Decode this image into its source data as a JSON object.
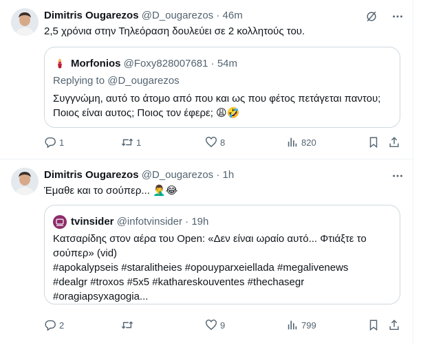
{
  "tweets": [
    {
      "author_name": "Dimitris Ougarezos",
      "handle": "@D_ougarezos",
      "dot": "·",
      "time": "46m",
      "text": "2,5 χρόνια στην Τηλεόραση δουλεύει σε 2 κολλητούς του.",
      "quote": {
        "author_name": "Morfonios",
        "handle": "@Foxy828007681",
        "time": "54m",
        "replying_to": "Replying to @D_ougarezos",
        "text_line1": "Συγγνώμη, αυτό το άτομο από που και ως που φέτος πετάγεται παντου;",
        "text_line2": "Ποιος είναι αυτος; Ποιος τον έφερε; 😩🤣"
      },
      "stats": {
        "replies": "1",
        "retweets": "1",
        "likes": "8",
        "views": "820"
      }
    },
    {
      "author_name": "Dimitris Ougarezos",
      "handle": "@D_ougarezos",
      "dot": "·",
      "time": "1h",
      "text": "Έμαθε και το σούπερ... 🤦‍♂️😂",
      "quote": {
        "author_name": "tvinsider",
        "handle": "@infotvinsider",
        "time": "19h",
        "text_line1": "Κατσαρίδης στον αέρα του Open: «Δεν είναι ωραίο αυτό... Φτιάξτε το",
        "text_line2": "σούπερ» (vid)",
        "text_line3": "#apokalypseis #staralitheies #opouyparxeiellada #megalivenews",
        "text_line4": "#dealgr #troxos #5x5 #kathareskouventes #thechasegr",
        "text_line5": "#oragiapsyxagogia..."
      },
      "stats": {
        "replies": "2",
        "retweets": "",
        "likes": "9",
        "views": "799"
      }
    }
  ],
  "icons": {
    "more": "more-horizontal-icon",
    "grok": "grok-slash-icon",
    "reply": "reply-bubble-icon",
    "retweet": "retweet-icon",
    "like": "heart-icon",
    "views": "bar-chart-icon",
    "bookmark": "bookmark-icon",
    "share": "share-upload-icon"
  },
  "colors": {
    "text": "#0f1419",
    "muted": "#536471",
    "border": "#cfd9de",
    "tvinsider_brand": "#8e2b6b"
  }
}
